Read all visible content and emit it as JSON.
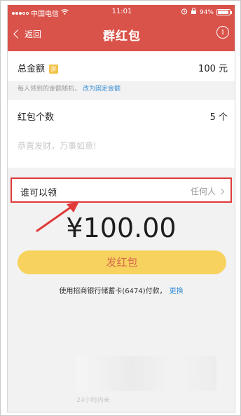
{
  "status_bar": {
    "carrier": "中国电信",
    "time": "11:01",
    "battery": "94%",
    "battery_level": 0.94
  },
  "nav": {
    "back_label": "返回",
    "title": "群红包"
  },
  "amount_row": {
    "label": "总金额",
    "badge": "拼",
    "value": "100 元"
  },
  "hint": {
    "text": "每人领到的金额随机，",
    "link": "改为固定金额"
  },
  "count_row": {
    "label": "红包个数",
    "value": "5 个"
  },
  "message": {
    "placeholder": "恭喜发财，万事如意!"
  },
  "who_row": {
    "label": "谁可以领",
    "value": "任何人"
  },
  "total_display": "¥100.00",
  "send_button": "发红包",
  "payment": {
    "text": "使用招商银行储蓄卡(6474)付款，",
    "link": "更换"
  },
  "footer": "24小时内未",
  "colors": {
    "header": "#d9534a",
    "button": "#f7d25e",
    "button_text": "#d66a4d",
    "link": "#3a8fd6",
    "highlight": "#e03a3a"
  }
}
